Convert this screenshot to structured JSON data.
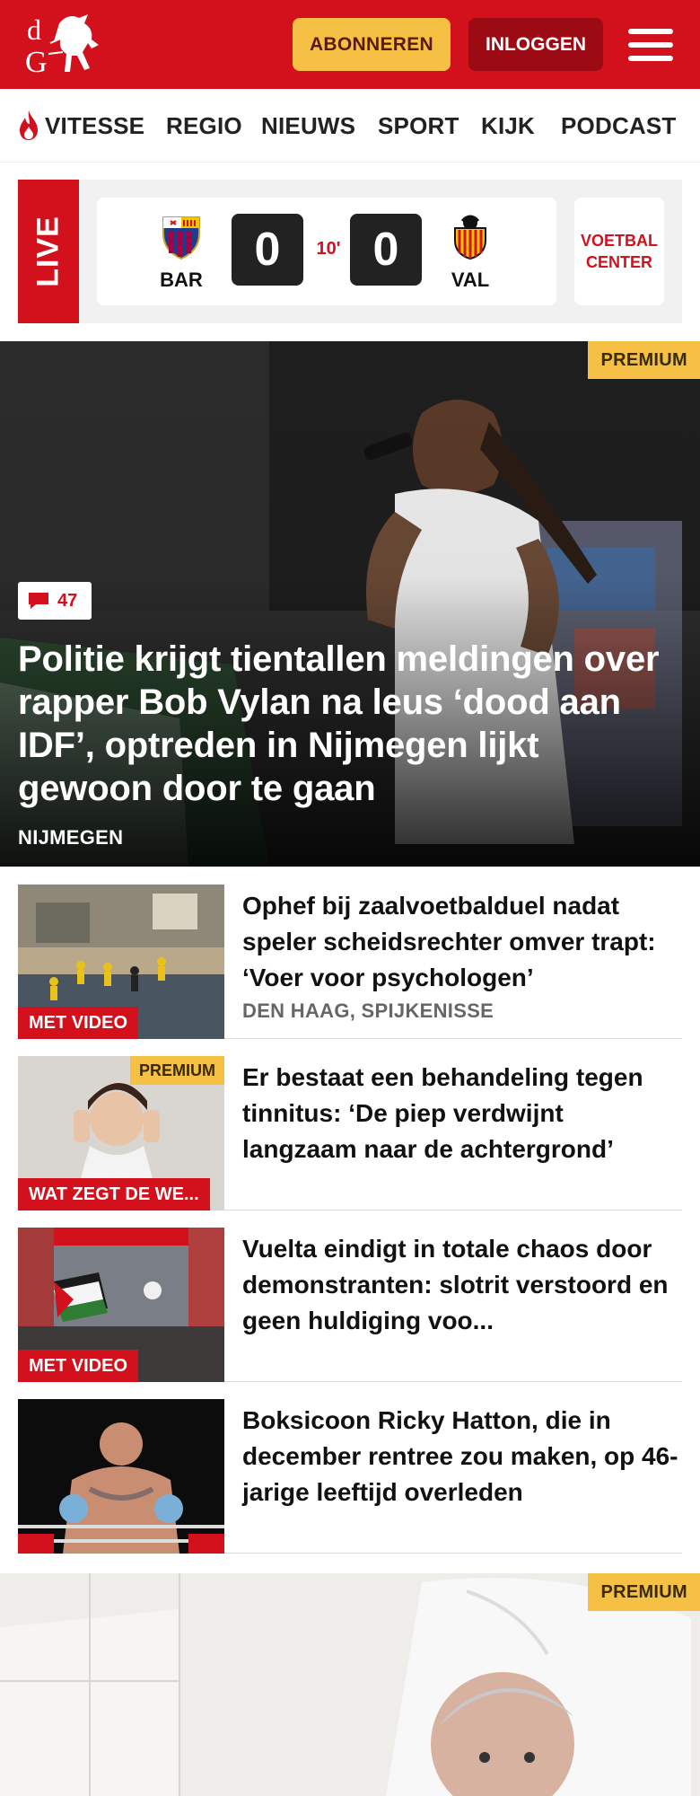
{
  "header": {
    "logo_text": "dG",
    "subscribe_label": "ABONNEREN",
    "login_label": "INLOGGEN",
    "brand_color": "#d2111d",
    "accent_color": "#f5c043"
  },
  "nav": {
    "items": [
      "VITESSE",
      "REGIO",
      "NIEUWS",
      "SPORT",
      "KIJK",
      "PODCAST"
    ]
  },
  "live": {
    "label": "LIVE",
    "home_team": "BAR",
    "away_team": "VAL",
    "home_score": "0",
    "away_score": "0",
    "minute": "10'",
    "center_label_1": "VOETBAL",
    "center_label_2": "CENTER"
  },
  "hero": {
    "premium_label": "PREMIUM",
    "comment_count": "47",
    "title": "Politie krijgt tientallen meldingen over rapper Bob Vylan na leus ‘dood aan IDF’, optreden in Nijmegen lijkt gewoon door te gaan",
    "location": "NIJMEGEN"
  },
  "articles": [
    {
      "tag": "MET VIDEO",
      "title": "Ophef bij zaalvoetbalduel nadat speler scheidsrechter omver trapt: ‘Voer voor psychologen’",
      "location": "DEN HAAG, SPIJKENISSE"
    },
    {
      "tag": "WAT ZEGT DE WE...",
      "premium_label": "PREMIUM",
      "title": "Er bestaat een behandeling tegen tinnitus: ‘De piep verdwijnt langzaam naar de achtergrond’"
    },
    {
      "tag": "MET VIDEO",
      "title": "Vuelta eindigt in totale chaos door demonstranten: slotrit verstoord en geen huldiging voo..."
    },
    {
      "title": "Boksicoon Ricky Hatton, die in december rentree zou maken, op 46-jarige leeftijd overleden"
    }
  ],
  "hero2": {
    "premium_label": "PREMIUM"
  }
}
